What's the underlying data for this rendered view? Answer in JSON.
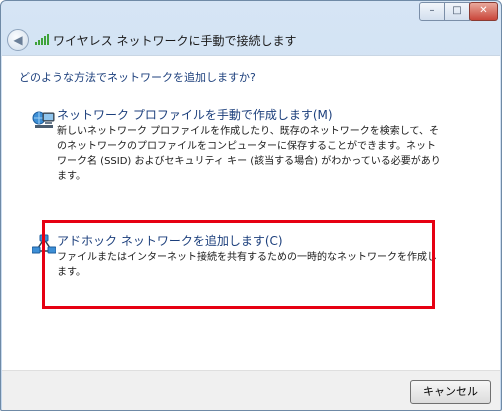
{
  "window": {
    "minimize_glyph": "–",
    "maximize_glyph": "□",
    "close_glyph": "✕"
  },
  "nav": {
    "back_glyph": "◀",
    "title": "ワイヤレス ネットワークに手動で接続します"
  },
  "content": {
    "question": "どのような方法でネットワークを追加しますか?",
    "options": [
      {
        "icon": "network-profile-icon",
        "title": "ネットワーク プロファイルを手動で作成します(M)",
        "description": "新しいネットワーク プロファイルを作成したり、既存のネットワークを検索して、そのネットワークのプロファイルをコンピューターに保存することができます。ネットワーク名 (SSID) およびセキュリティ キー (該当する場合) がわかっている必要があります。"
      },
      {
        "icon": "ad-hoc-network-icon",
        "title": "アドホック ネットワークを追加します(C)",
        "description": "ファイルまたはインターネット接続を共有するための一時的なネットワークを作成します。"
      }
    ],
    "highlight_color": "#e60012"
  },
  "footer": {
    "cancel_label": "キャンセル"
  }
}
